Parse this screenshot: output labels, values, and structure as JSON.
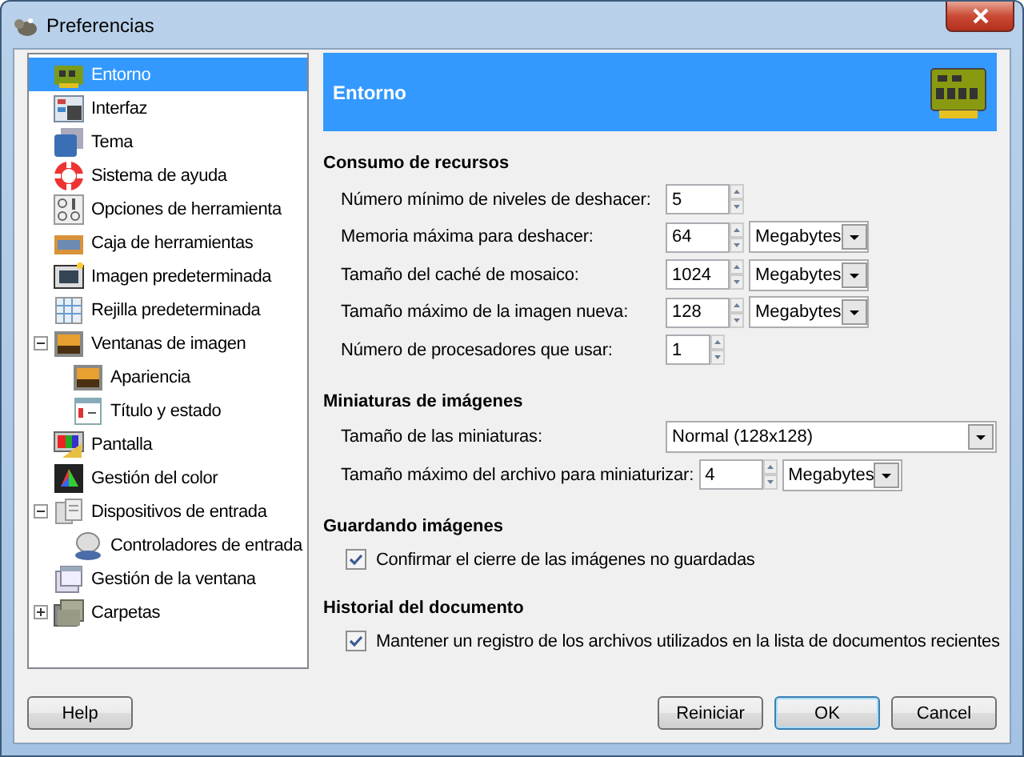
{
  "window": {
    "title": "Preferencias"
  },
  "tree": [
    {
      "label": "Entorno",
      "selected": true
    },
    {
      "label": "Interfaz",
      "selected": false
    },
    {
      "label": "Tema",
      "selected": false
    },
    {
      "label": "Sistema de ayuda",
      "selected": false
    },
    {
      "label": "Opciones de herramienta",
      "selected": false
    },
    {
      "label": "Caja de herramientas",
      "selected": false
    },
    {
      "label": "Imagen predeterminada",
      "selected": false
    },
    {
      "label": "Rejilla predeterminada",
      "selected": false
    },
    {
      "label": "Ventanas de imagen",
      "selected": false,
      "expanded": true,
      "children": [
        {
          "label": "Apariencia",
          "selected": false
        },
        {
          "label": "Título y estado",
          "selected": false
        }
      ]
    },
    {
      "label": "Pantalla",
      "selected": false
    },
    {
      "label": "Gestión del color",
      "selected": false
    },
    {
      "label": "Dispositivos de entrada",
      "selected": false,
      "expanded": true,
      "children": [
        {
          "label": "Controladores de entrada",
          "selected": false
        }
      ]
    },
    {
      "label": "Gestión de la ventana",
      "selected": false
    },
    {
      "label": "Carpetas",
      "selected": false,
      "expanded": false
    }
  ],
  "page": {
    "title": "Entorno",
    "sections": [
      {
        "title": "Consumo de recursos",
        "rows": [
          {
            "kind": "spin",
            "label": "Número mínimo de niveles de deshacer:",
            "value": "5"
          },
          {
            "kind": "spin",
            "label": "Memoria máxima para deshacer:",
            "value": "64",
            "unit": "Megabytes"
          },
          {
            "kind": "spin",
            "label": "Tamaño del caché de mosaico:",
            "value": "1024",
            "unit": "Megabytes"
          },
          {
            "kind": "spin",
            "label": "Tamaño máximo de la imagen nueva:",
            "value": "128",
            "unit": "Megabytes"
          },
          {
            "kind": "spin-small",
            "label": "Número de procesadores que usar:",
            "value": "1"
          }
        ]
      },
      {
        "title": "Miniaturas de imágenes",
        "rows": [
          {
            "kind": "combo",
            "label": "Tamaño de las miniaturas:",
            "value": "Normal (128x128)"
          },
          {
            "kind": "spin",
            "label": "Tamaño máximo del archivo para miniaturizar:",
            "value": "4",
            "unit": "Megabytes"
          }
        ]
      },
      {
        "title": "Guardando imágenes",
        "rows": [
          {
            "kind": "check",
            "label": "Confirmar el cierre de las imágenes no guardadas",
            "checked": true
          }
        ]
      },
      {
        "title": "Historial del documento",
        "rows": [
          {
            "kind": "check",
            "label": "Mantener un registro de los archivos utilizados en la lista de documentos recientes",
            "checked": true
          }
        ]
      }
    ]
  },
  "buttons": [
    {
      "label": "Help",
      "focused": false
    },
    {
      "label": "Reiniciar",
      "focused": false
    },
    {
      "label": "OK",
      "focused": true
    },
    {
      "label": "Cancel",
      "focused": false
    }
  ]
}
